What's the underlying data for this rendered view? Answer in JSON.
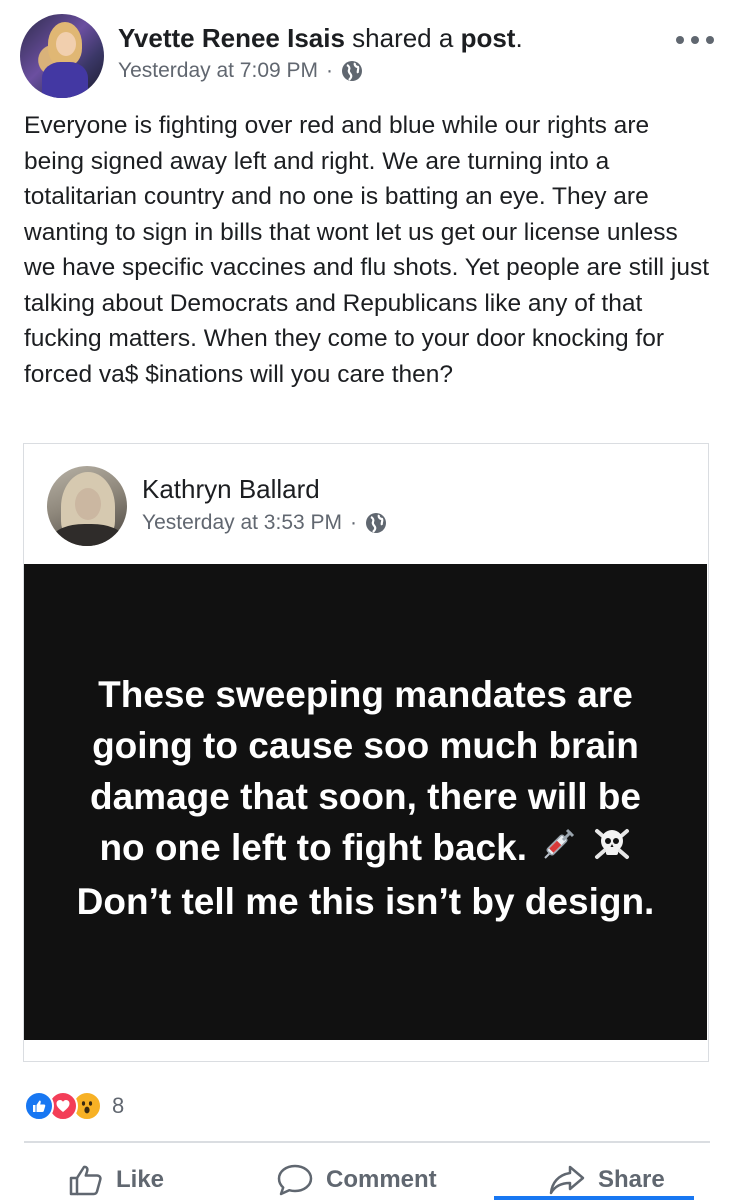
{
  "post": {
    "author_name": "Yvette Renee Isais",
    "shared_text": " shared a ",
    "post_link": "post",
    "post_link_suffix": ".",
    "timestamp": "Yesterday at 7:09 PM",
    "dot": "·",
    "audience_icon": "globe-icon",
    "caption": "Everyone is fighting over red and blue while our rights are being signed away left and right. We are turning into a totalitarian country and no one is batting an eye. They are wanting to sign in bills that wont let us get our license unless we have specific vaccines and flu shots. Yet people are still just talking about Democrats and Republicans like any of that fucking matters. When they come to your door knocking for forced va$ $inations will you care then?"
  },
  "shared_post": {
    "author_name": "Kathryn Ballard",
    "timestamp": "Yesterday at 3:53 PM",
    "dot": "·",
    "audience_icon": "globe-icon",
    "image_text_1": "These sweeping mandates are going to cause soo much brain damage that soon, there will be no one left to fight back.",
    "emoji_icons": [
      "syringe-icon",
      "skull-crossbones-icon"
    ],
    "image_text_2": "Don’t tell me this isn’t by design."
  },
  "reactions": {
    "icons": [
      "like-reaction",
      "love-reaction",
      "wow-reaction"
    ],
    "count": "8"
  },
  "actions": {
    "like_label": "Like",
    "comment_label": "Comment",
    "share_label": "Share"
  },
  "colors": {
    "accent": "#1877f2",
    "love": "#f33e58",
    "wow": "#f7b125",
    "secondary_text": "#616770",
    "image_background": "#111111"
  }
}
